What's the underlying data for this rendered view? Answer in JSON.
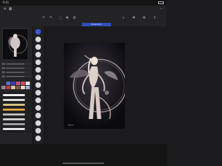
{
  "status_bar": {
    "time": "9:41"
  },
  "document_tab": {
    "label": "Illustration"
  },
  "artwork": {
    "signature": "Ren"
  },
  "palette": [
    "#2a2a2e",
    "#5c6fd1",
    "#3b3fb2",
    "#c94f7a",
    "#d04a5f",
    "#e9e9e9",
    "#8a8a90",
    "#c13c3c",
    "#d8c0ad",
    "#7b5b45",
    "#f0d7bf",
    "#9fb0d8"
  ],
  "brushes": [
    {
      "color": "#f2f2f2"
    },
    {
      "color": "#e0e0e0"
    },
    {
      "color": "#d6c27a"
    },
    {
      "color": "#e0a63d"
    },
    {
      "color": "#bdbdbd"
    },
    {
      "color": "#cfcfcf"
    },
    {
      "color": "#9e9e9e"
    },
    {
      "color": "#e6e6e6"
    }
  ]
}
